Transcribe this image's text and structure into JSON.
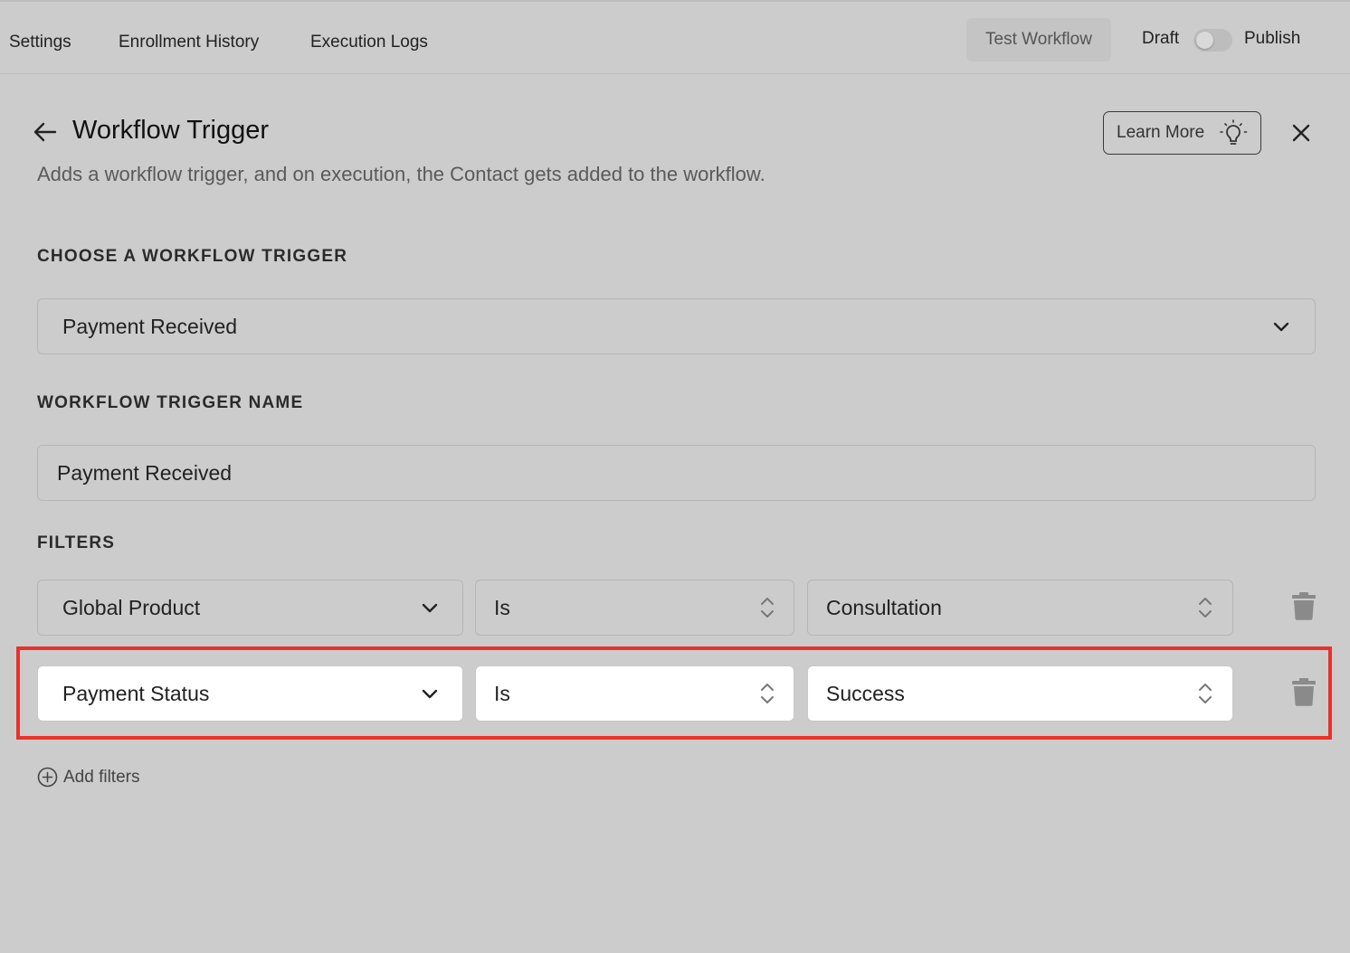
{
  "topbar": {
    "tabs": [
      "Settings",
      "Enrollment History",
      "Execution Logs"
    ],
    "test_workflow": "Test Workflow",
    "draft": "Draft",
    "publish": "Publish"
  },
  "panel": {
    "title": "Workflow Trigger",
    "subtitle": "Adds a workflow trigger, and on execution, the Contact gets added to the workflow.",
    "learn_more": "Learn More"
  },
  "trigger": {
    "label": "CHOOSE A WORKFLOW TRIGGER",
    "selected": "Payment Received"
  },
  "trigger_name": {
    "label": "WORKFLOW TRIGGER NAME",
    "value": "Payment Received"
  },
  "filters": {
    "label": "FILTERS",
    "rows": [
      {
        "field": "Global Product",
        "operator": "Is",
        "value": "Consultation"
      },
      {
        "field": "Payment Status",
        "operator": "Is",
        "value": "Success"
      }
    ],
    "add_label": "Add filters"
  },
  "colors": {
    "background": "#cccccc",
    "highlight": "#e8322a"
  }
}
